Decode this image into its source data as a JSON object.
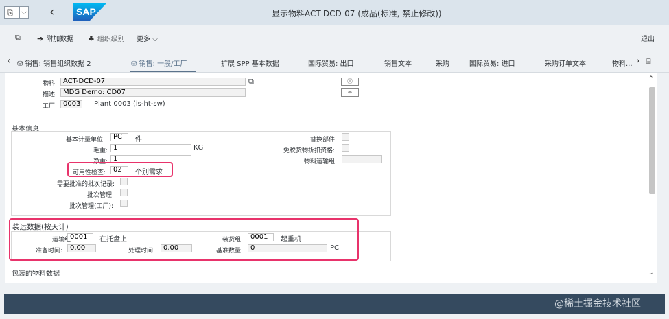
{
  "titlebar": {
    "title": "显示物料ACT-DCD-07 (成品(标准, 禁止修改))",
    "cmd_icon": "command-field-icon",
    "dropdown_icon": "chevron-down-icon",
    "back_icon": "back-icon",
    "logo": "sap-logo"
  },
  "toolbar": {
    "items": [
      {
        "icon": "other-view-icon",
        "label": ""
      },
      {
        "icon": "arrow-right-icon",
        "label": "附加数据"
      },
      {
        "icon": "org-levels-icon",
        "label": "组织级别"
      },
      {
        "icon": "chevron-down-icon",
        "label": "更多"
      }
    ],
    "exit_label": "退出"
  },
  "tabs": {
    "items": [
      {
        "label": "销售: 销售组织数据 2",
        "icon": "tab-icon"
      },
      {
        "label": "销售: 一般/工厂",
        "icon": "tab-icon",
        "active": true
      },
      {
        "label": "扩展 SPP 基本数据"
      },
      {
        "label": "国际贸易: 出口"
      },
      {
        "label": "销售文本"
      },
      {
        "label": "采购"
      },
      {
        "label": "国际贸易: 进口"
      },
      {
        "label": "采购订单文本"
      },
      {
        "label": "物料..."
      }
    ],
    "prev_icon": "chevron-left-icon",
    "next_icon": "chevron-right-icon"
  },
  "header": {
    "material_label": "物料:",
    "material_value": "ACT-DCD-07",
    "desc_label": "描述:",
    "desc_value": "MDG Demo: CD07",
    "plant_label": "工厂:",
    "plant_value": "0003",
    "plant_text": "Plant 0003 (is-ht-sw)"
  },
  "basic": {
    "title": "基本信息",
    "base_uom_label": "基本计量单位:",
    "base_uom_value": "PC",
    "base_uom_text": "件",
    "gross_label": "毛重:",
    "gross_value": "1",
    "gross_unit": "KG",
    "net_label": "净重:",
    "net_value": "1",
    "avail_label": "可用性检查:",
    "avail_value": "02",
    "avail_text": "个别需求",
    "batch_record_label": "需要批准的批次记录:",
    "batch_mgmt_label": "批次管理:",
    "batch_mgmt_plant_label": "批次管理(工厂):",
    "replacement_label": "替换部件:",
    "tax_label": "免税货物折扣资格:",
    "freight_group_label": "物料运输组:"
  },
  "shipping": {
    "title": "装运数据(按天计)",
    "trans_group_label": "运输组:",
    "trans_group_value": "0001",
    "trans_group_text": "在托盘上",
    "loading_group_label": "装货组:",
    "loading_group_value": "0001",
    "loading_group_text": "起重机",
    "setup_time_label": "准备时间:",
    "setup_time_value": "0.00",
    "proc_time_label": "处理时间:",
    "proc_time_value": "0.00",
    "base_qty_label": "基准数量:",
    "base_qty_value": "0",
    "base_qty_unit": "PC"
  },
  "packaging": {
    "title": "包装的物料数据"
  },
  "watermark": "@稀土掘金技术社区"
}
